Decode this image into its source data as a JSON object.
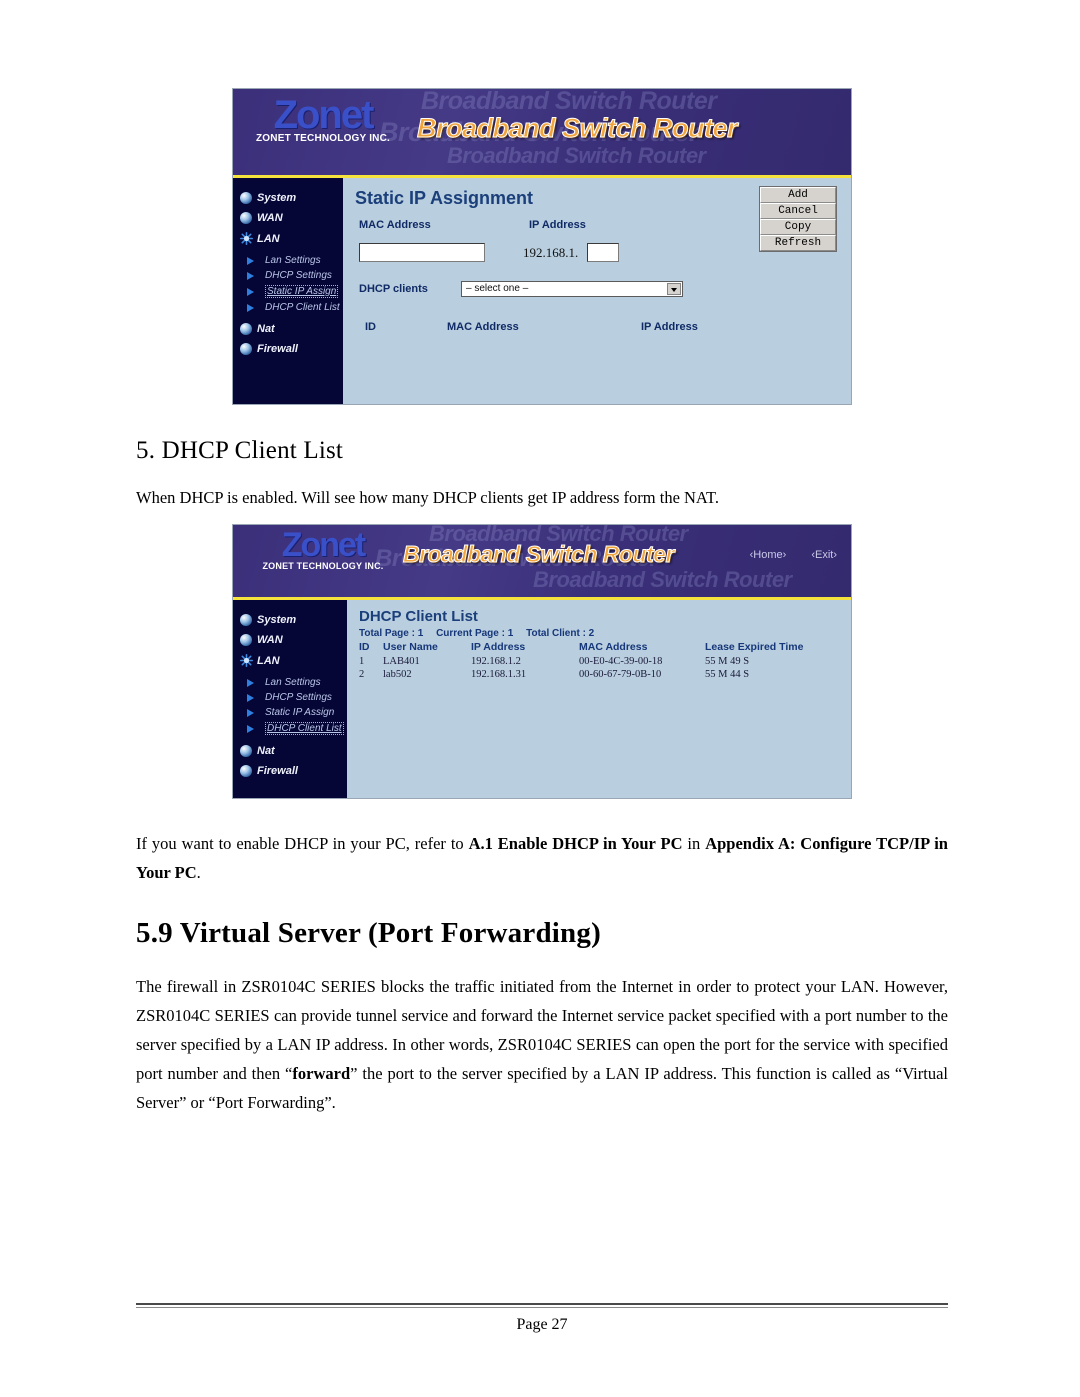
{
  "document": {
    "section_heading_sub": "5.  DHCP Client List",
    "paragraph_dhcp": "When DHCP is enabled. Will see how many DHCP clients get IP address form the NAT.",
    "paragraph_appendix_prefix": "If you want to enable DHCP in your PC, refer to ",
    "paragraph_appendix_bold1": "A.1 Enable DHCP in Your PC",
    "paragraph_appendix_mid": " in ",
    "paragraph_appendix_bold2": "Appendix A: Configure TCP/IP in Your PC",
    "paragraph_appendix_end": ".",
    "section_heading_main": "5.9 Virtual Server (Port Forwarding)",
    "paragraph_virtual_part1": "The firewall in ZSR0104C SERIES blocks the traffic initiated from the Internet in order to protect your LAN. However, ZSR0104C SERIES can provide tunnel service and forward the Internet service packet specified with a port number to the server specified by a LAN IP address. In other words, ZSR0104C SERIES can open the port for the service with specified port number and then “",
    "paragraph_virtual_bold": "forward",
    "paragraph_virtual_part2": "” the port to the server specified by a LAN IP address. This function is called as “Virtual Server” or “Port Forwarding”.",
    "footer_page": "Page 27"
  },
  "colors": {
    "banner_purple": "#3b2f7a",
    "sidebar_navy": "#060636",
    "content_blue": "#b9cede",
    "title_blue": "#1b3f7a",
    "accent_yellow": "#f5e23c",
    "bsr_orange": "#f2a43c",
    "zonet_blue": "#3a50c8"
  },
  "router_ui": {
    "brand_word": "Zonet",
    "brand_sub": "ZONET TECHNOLOGY INC.",
    "banner_title": "Broadband Switch Router",
    "banner_ghost": "Broadband Switch Router",
    "nav_home": "‹Home›",
    "nav_exit": "‹Exit›",
    "sidebar": [
      {
        "label": "System",
        "icon": "globe-ball-icon",
        "type": "top"
      },
      {
        "label": "WAN",
        "icon": "globe-ball-icon",
        "type": "top"
      },
      {
        "label": "LAN",
        "icon": "star-burst-icon",
        "type": "top"
      },
      {
        "label": "Lan Settings",
        "icon": "arrow-bullet-icon",
        "type": "sub"
      },
      {
        "label": "DHCP Settings",
        "icon": "arrow-bullet-icon",
        "type": "sub"
      },
      {
        "label": "Static IP Assign",
        "icon": "arrow-bullet-icon",
        "type": "sub"
      },
      {
        "label": "DHCP Client List",
        "icon": "arrow-bullet-icon",
        "type": "sub"
      },
      {
        "label": "Nat",
        "icon": "globe-ball-icon",
        "type": "top"
      },
      {
        "label": "Firewall",
        "icon": "globe-ball-icon",
        "type": "top"
      }
    ]
  },
  "screenshot_static_ip": {
    "panel_title": "Static IP Assignment",
    "label_mac_address": "MAC Address",
    "label_ip_address": "IP Address",
    "mac_input_value": "",
    "ip_prefix": "192.168.1.",
    "ip_last_octet_value": "",
    "label_dhcp_clients": "DHCP clients",
    "dhcp_select_value": "– select one –",
    "buttons": [
      "Add",
      "Cancel",
      "Copy",
      "Refresh"
    ],
    "table_headers": [
      "ID",
      "MAC Address",
      "IP Address"
    ],
    "active_sidebar_item": "Static IP Assign"
  },
  "screenshot_dhcp_list": {
    "panel_title": "DHCP Client List",
    "stats": {
      "total_page_label": "Total Page : 1",
      "current_page_label": "Current Page : 1",
      "total_client_label": "Total Client : 2"
    },
    "table_headers": [
      "ID",
      "User Name",
      "IP Address",
      "MAC Address",
      "Lease Expired Time"
    ],
    "rows": [
      {
        "id": "1",
        "user_name": "LAB401",
        "ip_address": "192.168.1.2",
        "mac_address": "00-E0-4C-39-00-18",
        "lease": "55 M 49 S"
      },
      {
        "id": "2",
        "user_name": "lab502",
        "ip_address": "192.168.1.31",
        "mac_address": "00-60-67-79-0B-10",
        "lease": "55 M 44 S"
      }
    ],
    "active_sidebar_item": "DHCP Client List"
  }
}
